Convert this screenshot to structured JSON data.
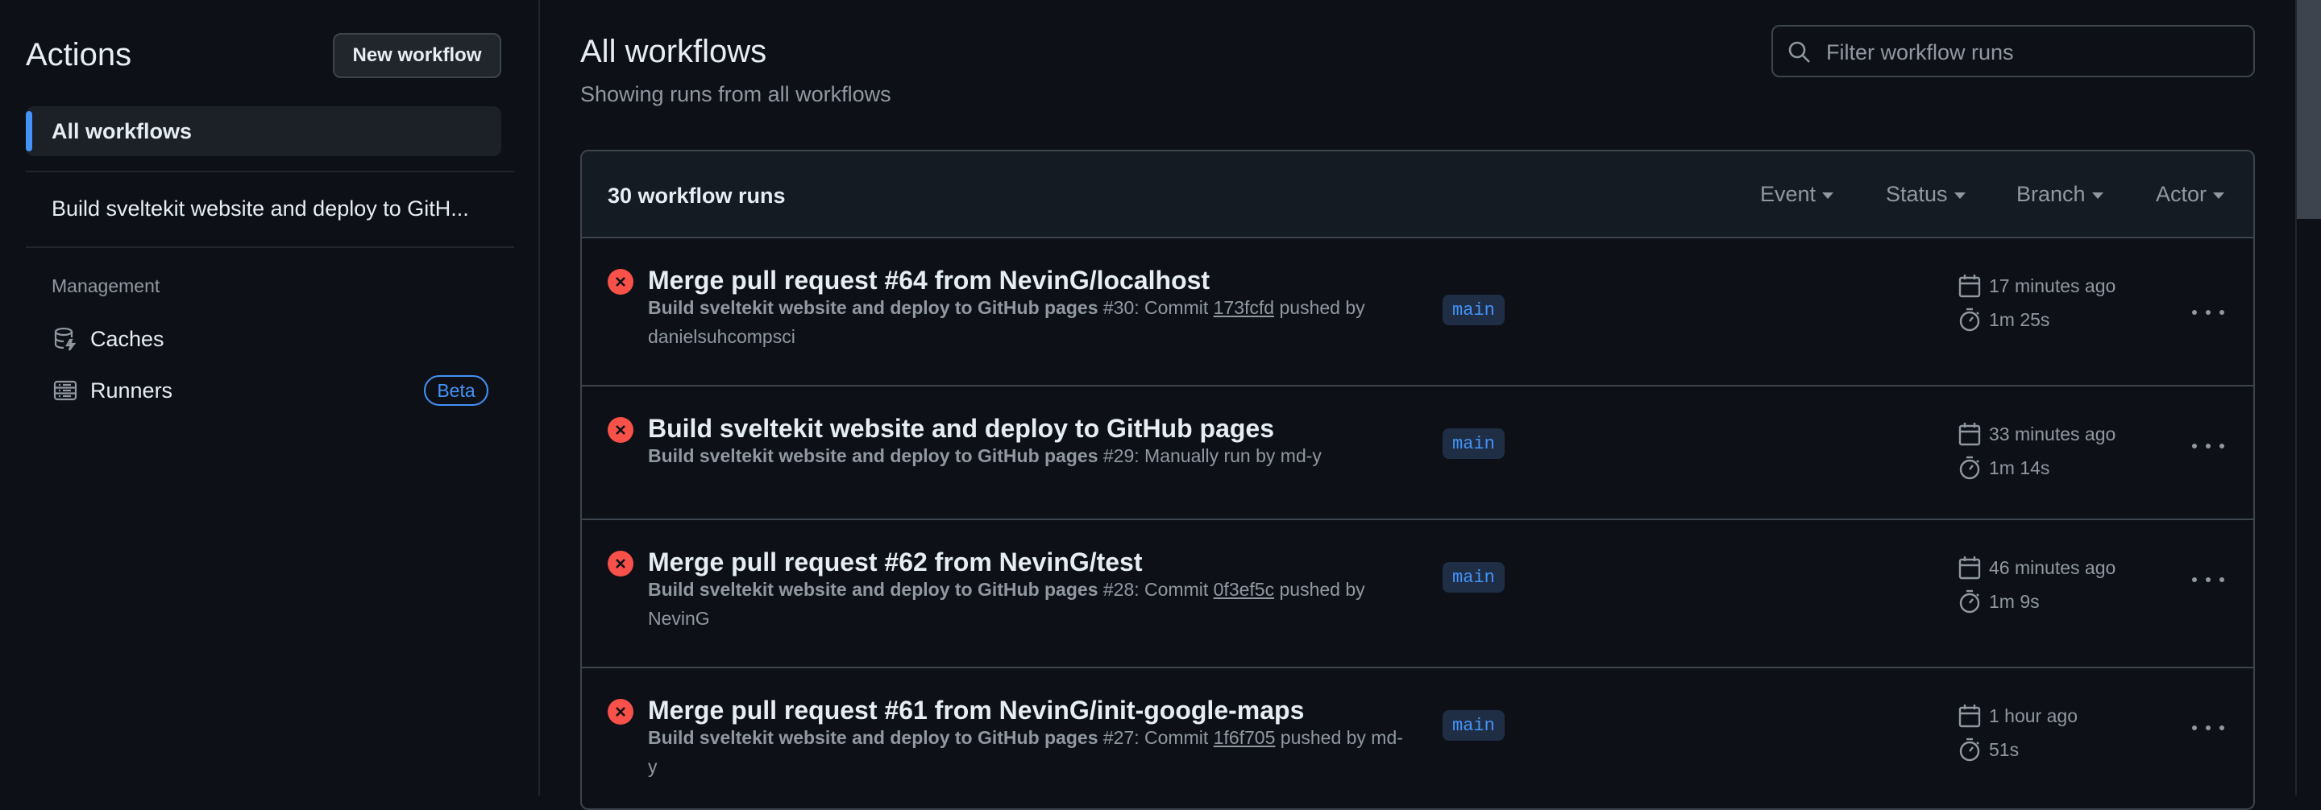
{
  "sidebar": {
    "title": "Actions",
    "new_workflow_label": "New workflow",
    "active_item": "All workflows",
    "workflow_item": "Build sveltekit website and deploy to GitH...",
    "section_label": "Management",
    "items": [
      {
        "label": "Caches",
        "icon": "database-icon"
      },
      {
        "label": "Runners",
        "icon": "server-icon",
        "badge": "Beta"
      }
    ]
  },
  "main": {
    "title": "All workflows",
    "subtitle": "Showing runs from all workflows",
    "search": {
      "placeholder": "Filter workflow runs",
      "value": ""
    },
    "run_count": "30 workflow runs",
    "filters": [
      "Event",
      "Status",
      "Branch",
      "Actor"
    ],
    "runs": [
      {
        "title": "Merge pull request #64 from NevinG/localhost",
        "workflow": "Build sveltekit website and deploy to GitHub pages",
        "run_number": "#30",
        "pre": ": Commit ",
        "sha": "173fcfd",
        "line1_tail": " pushed by",
        "line2": "danielsuhcompsci",
        "branch": "main",
        "when": "17 minutes ago",
        "duration": "1m 25s",
        "status": "failure"
      },
      {
        "title": "Build sveltekit website and deploy to GitHub pages",
        "workflow": "Build sveltekit website and deploy to GitHub pages",
        "run_number": "#29",
        "pre": ": Manually run by md-y",
        "sha": "",
        "line1_tail": "",
        "line2": "",
        "branch": "main",
        "when": "33 minutes ago",
        "duration": "1m 14s",
        "status": "failure"
      },
      {
        "title": "Merge pull request #62 from NevinG/test",
        "workflow": "Build sveltekit website and deploy to GitHub pages",
        "run_number": "#28",
        "pre": ": Commit ",
        "sha": "0f3ef5c",
        "line1_tail": " pushed by",
        "line2": "NevinG",
        "branch": "main",
        "when": "46 minutes ago",
        "duration": "1m 9s",
        "status": "failure"
      },
      {
        "title": "Merge pull request #61 from NevinG/init-google-maps",
        "workflow": "Build sveltekit website and deploy to GitHub pages",
        "run_number": "#27",
        "pre": ": Commit ",
        "sha": "1f6f705",
        "line1_tail": " pushed by md-",
        "line2": "y",
        "branch": "main",
        "when": "1 hour ago",
        "duration": "51s",
        "status": "failure"
      }
    ]
  },
  "colors": {
    "background": "#0d1117",
    "accent": "#4493f8",
    "failure": "#f85149",
    "muted_text": "#9198a1"
  }
}
